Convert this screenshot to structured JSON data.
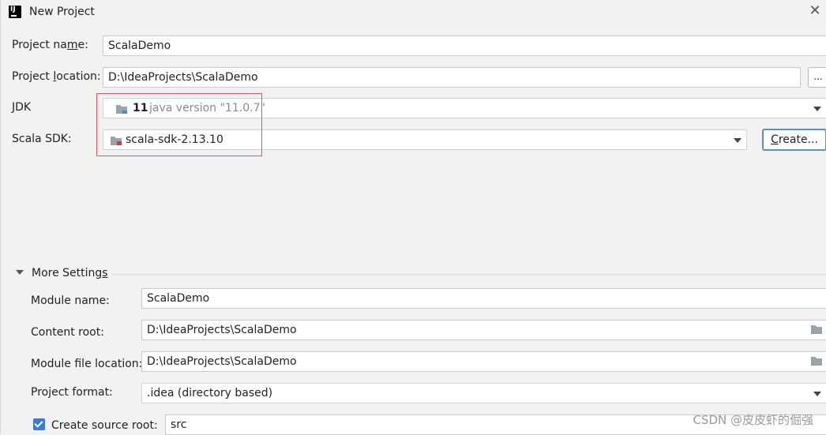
{
  "window": {
    "title": "New Project"
  },
  "project": {
    "name_label_pre": "Project na",
    "name_label_u": "m",
    "name_label_post": "e:",
    "name_value": "ScalaDemo",
    "location_label_pre": "Project ",
    "location_label_u": "l",
    "location_label_post": "ocation:",
    "location_value": "D:\\IdeaProjects\\ScalaDemo",
    "browse_label": "...",
    "jdk_label_u": "J",
    "jdk_label_post": "DK",
    "jdk_version": "11",
    "jdk_desc": "java version \"11.0.7\"",
    "scala_sdk_label": "Scala SDK:",
    "scala_sdk_value": "scala-sdk-2.13.10",
    "create_label_u": "C",
    "create_label_post": "reate..."
  },
  "more_settings": {
    "header_pre": "More Setting",
    "header_u": "s",
    "header_post": "",
    "module_name_label": "Module name:",
    "module_name_value": "ScalaDemo",
    "content_root_label": "Content root:",
    "content_root_value": "D:\\IdeaProjects\\ScalaDemo",
    "module_file_label": "Module file location:",
    "module_file_value": "D:\\IdeaProjects\\ScalaDemo",
    "project_format_label": "Project format:",
    "project_format_value": ".idea (directory based)",
    "source_root_label": "Create source root:",
    "source_root_checked": true,
    "source_root_value": "src"
  },
  "watermark": "CSDN @皮皮虾的倔强",
  "colors": {
    "highlight_box": "#e05a5a",
    "default_button_border": "#5a8fd0",
    "checkbox": "#3d7bd4"
  }
}
